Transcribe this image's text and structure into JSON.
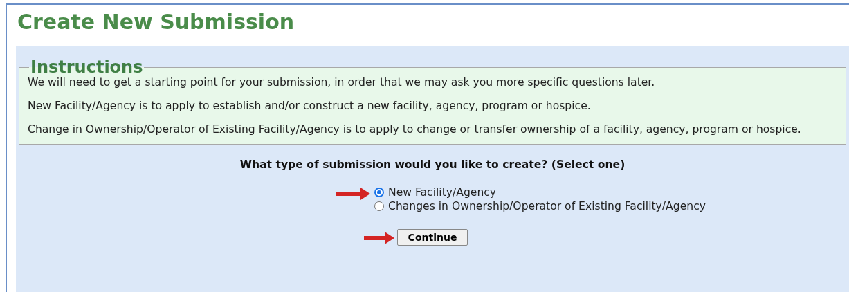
{
  "title": "Create New Submission",
  "instructions": {
    "legend": "Instructions",
    "paragraphs": [
      "We will need to get a starting point for your submission, in order that we may ask you more specific questions later.",
      "New Facility/Agency is to apply to establish and/or construct a new facility, agency, program or hospice.",
      "Change in Ownership/Operator of Existing Facility/Agency is to apply to change or transfer ownership of a facility, agency, program or hospice."
    ]
  },
  "question": "What type of submission would you like to create? (Select one)",
  "options": [
    {
      "label": "New Facility/Agency",
      "selected": true
    },
    {
      "label": "Changes in Ownership/Operator of Existing Facility/Agency",
      "selected": false
    }
  ],
  "continue_button": "Continue"
}
